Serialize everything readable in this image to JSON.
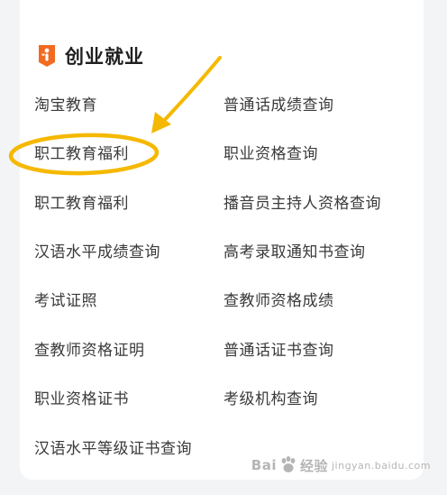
{
  "section": {
    "title": "创业就业",
    "icon": "career-badge-icon",
    "accent": "#f26a21"
  },
  "links_left": [
    "淘宝教育",
    "职工教育福利",
    "职工教育福利",
    "汉语水平成绩查询",
    "考试证照",
    "查教师资格证明",
    "职业资格证书",
    "汉语水平等级证书查询"
  ],
  "links_right": [
    "普通话成绩查询",
    "职业资格查询",
    "播音员主持人资格查询",
    "高考录取通知书查询",
    "查教师资格成绩",
    "普通话证书查询",
    "考级机构查询"
  ],
  "annotation": {
    "color": "#f5b800",
    "target": "职工教育福利",
    "icon": "arrow-pointer-icon"
  },
  "watermark": {
    "left": "Bai",
    "right": "经验",
    "sub": "jingyan.baidu.com"
  }
}
